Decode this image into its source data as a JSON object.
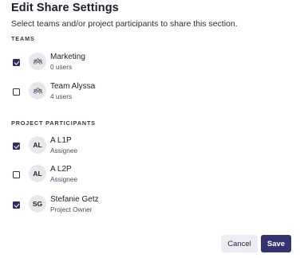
{
  "dialog": {
    "title": "Edit Share Settings",
    "subtitle": "Select teams and/or project participants to share this section."
  },
  "teams": {
    "label": "TEAMS",
    "items": [
      {
        "name": "Marketing",
        "meta": "0 users",
        "checked": true,
        "icon": "team-icon"
      },
      {
        "name": "Team Alyssa",
        "meta": "4 users",
        "checked": false,
        "icon": "team-icon"
      }
    ]
  },
  "participants": {
    "label": "PROJECT PARTICIPANTS",
    "items": [
      {
        "initials": "AL",
        "name": "A L1P",
        "meta": "Assignee",
        "checked": true
      },
      {
        "initials": "AL",
        "name": "A L2P",
        "meta": "Assignee",
        "checked": false
      },
      {
        "initials": "SG",
        "name": "Stefanie Getz",
        "meta": "Project Owner",
        "checked": true
      }
    ]
  },
  "footer": {
    "cancel_label": "Cancel",
    "save_label": "Save"
  },
  "colors": {
    "primary": "#34326f",
    "checkbox_checked": "#2f2f5e",
    "avatar_bg": "#e8e8ec",
    "cancel_bg": "#ececf2"
  }
}
